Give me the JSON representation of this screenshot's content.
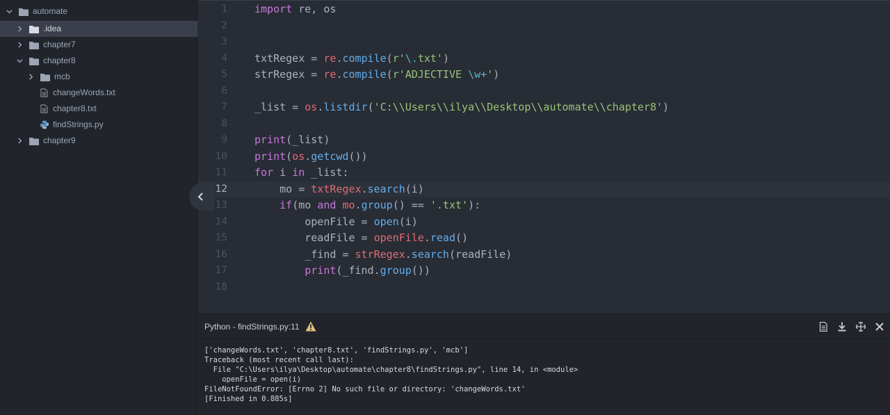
{
  "tree": {
    "root": "automate",
    "items": [
      {
        "label": ".idea",
        "kind": "folder",
        "state": "collapsed",
        "depth": 1,
        "selected": true
      },
      {
        "label": "chapter7",
        "kind": "folder",
        "state": "collapsed",
        "depth": 1,
        "selected": false
      },
      {
        "label": "chapter8",
        "kind": "folder",
        "state": "expanded",
        "depth": 1,
        "selected": false
      },
      {
        "label": "mcb",
        "kind": "folder",
        "state": "collapsed",
        "depth": 2,
        "selected": false
      },
      {
        "label": "changeWords.txt",
        "kind": "file-text",
        "depth": 2,
        "selected": false
      },
      {
        "label": "chapter8.txt",
        "kind": "file-text",
        "depth": 2,
        "selected": false
      },
      {
        "label": "findStrings.py",
        "kind": "file-python",
        "depth": 2,
        "selected": false
      },
      {
        "label": "chapter9",
        "kind": "folder",
        "state": "collapsed",
        "depth": 1,
        "selected": false
      }
    ]
  },
  "editor": {
    "cursor_line": 12,
    "lines": [
      {
        "no": "1",
        "tokens": [
          {
            "t": "import",
            "c": "kw"
          },
          {
            "t": " re, os",
            "c": "pl"
          }
        ]
      },
      {
        "no": "2",
        "tokens": []
      },
      {
        "no": "3",
        "tokens": []
      },
      {
        "no": "4",
        "tokens": [
          {
            "t": "txtRegex = ",
            "c": "pl"
          },
          {
            "t": "re",
            "c": "var"
          },
          {
            "t": ".",
            "c": "pl"
          },
          {
            "t": "compile",
            "c": "fn"
          },
          {
            "t": "(",
            "c": "pl"
          },
          {
            "t": "r'",
            "c": "str"
          },
          {
            "t": "\\.",
            "c": "esc"
          },
          {
            "t": "txt'",
            "c": "str"
          },
          {
            "t": ")",
            "c": "pl"
          }
        ]
      },
      {
        "no": "5",
        "tokens": [
          {
            "t": "strRegex = ",
            "c": "pl"
          },
          {
            "t": "re",
            "c": "var"
          },
          {
            "t": ".",
            "c": "pl"
          },
          {
            "t": "compile",
            "c": "fn"
          },
          {
            "t": "(",
            "c": "pl"
          },
          {
            "t": "r'ADJECTIVE ",
            "c": "str"
          },
          {
            "t": "\\w+",
            "c": "esc"
          },
          {
            "t": "'",
            "c": "str"
          },
          {
            "t": ")",
            "c": "pl"
          }
        ]
      },
      {
        "no": "6",
        "tokens": []
      },
      {
        "no": "7",
        "tokens": [
          {
            "t": "_list = ",
            "c": "pl"
          },
          {
            "t": "os",
            "c": "var"
          },
          {
            "t": ".",
            "c": "pl"
          },
          {
            "t": "listdir",
            "c": "fn"
          },
          {
            "t": "(",
            "c": "pl"
          },
          {
            "t": "'C:\\\\Users\\\\ilya\\\\Desktop\\\\automate\\\\chapter8'",
            "c": "str"
          },
          {
            "t": ")",
            "c": "pl"
          }
        ]
      },
      {
        "no": "8",
        "tokens": []
      },
      {
        "no": "9",
        "tokens": [
          {
            "t": "print",
            "c": "kw"
          },
          {
            "t": "(_list)",
            "c": "pl"
          }
        ]
      },
      {
        "no": "10",
        "tokens": [
          {
            "t": "print",
            "c": "kw"
          },
          {
            "t": "(",
            "c": "pl"
          },
          {
            "t": "os",
            "c": "var"
          },
          {
            "t": ".",
            "c": "pl"
          },
          {
            "t": "getcwd",
            "c": "fn"
          },
          {
            "t": "())",
            "c": "pl"
          }
        ]
      },
      {
        "no": "11",
        "tokens": [
          {
            "t": "for",
            "c": "kw"
          },
          {
            "t": " i ",
            "c": "pl"
          },
          {
            "t": "in",
            "c": "kw"
          },
          {
            "t": " _list:",
            "c": "pl"
          }
        ]
      },
      {
        "no": "12",
        "tokens": [
          {
            "t": "    mo = ",
            "c": "pl"
          },
          {
            "t": "txtRegex",
            "c": "var"
          },
          {
            "t": ".",
            "c": "pl"
          },
          {
            "t": "search",
            "c": "fn"
          },
          {
            "t": "(i)",
            "c": "pl"
          }
        ]
      },
      {
        "no": "13",
        "tokens": [
          {
            "t": "    ",
            "c": "pl"
          },
          {
            "t": "if",
            "c": "kw"
          },
          {
            "t": "(mo ",
            "c": "pl"
          },
          {
            "t": "and",
            "c": "kw"
          },
          {
            "t": " ",
            "c": "pl"
          },
          {
            "t": "mo",
            "c": "var"
          },
          {
            "t": ".",
            "c": "pl"
          },
          {
            "t": "group",
            "c": "fn"
          },
          {
            "t": "() == ",
            "c": "pl"
          },
          {
            "t": "'.txt'",
            "c": "str"
          },
          {
            "t": "):",
            "c": "pl"
          }
        ]
      },
      {
        "no": "14",
        "tokens": [
          {
            "t": "        openFile = ",
            "c": "pl"
          },
          {
            "t": "open",
            "c": "fn"
          },
          {
            "t": "(i)",
            "c": "pl"
          }
        ]
      },
      {
        "no": "15",
        "tokens": [
          {
            "t": "        readFile = ",
            "c": "pl"
          },
          {
            "t": "openFile",
            "c": "var"
          },
          {
            "t": ".",
            "c": "pl"
          },
          {
            "t": "read",
            "c": "fn"
          },
          {
            "t": "()",
            "c": "pl"
          }
        ]
      },
      {
        "no": "16",
        "tokens": [
          {
            "t": "        _find = ",
            "c": "pl"
          },
          {
            "t": "strRegex",
            "c": "var"
          },
          {
            "t": ".",
            "c": "pl"
          },
          {
            "t": "search",
            "c": "fn"
          },
          {
            "t": "(readFile)",
            "c": "pl"
          }
        ]
      },
      {
        "no": "17",
        "tokens": [
          {
            "t": "        ",
            "c": "pl"
          },
          {
            "t": "print",
            "c": "kw"
          },
          {
            "t": "(_find.",
            "c": "pl"
          },
          {
            "t": "group",
            "c": "fn"
          },
          {
            "t": "())",
            "c": "pl"
          }
        ]
      },
      {
        "no": "18",
        "tokens": []
      }
    ]
  },
  "panel": {
    "title": "Python - findStrings.py:11",
    "output": [
      "['changeWords.txt', 'chapter8.txt', 'findStrings.py', 'mcb']",
      "Traceback (most recent call last):",
      "  File \"C:\\Users\\ilya\\Desktop\\automate\\chapter8\\findStrings.py\", line 14, in <module>",
      "    openFile = open(i)",
      "FileNotFoundError: [Errno 2] No such file or directory: 'changeWords.txt'",
      "[Finished in 0.885s]"
    ],
    "actions": [
      "document-icon",
      "download-icon",
      "pin-icon",
      "close-icon"
    ]
  },
  "colors": {
    "keyword": "#c678dd",
    "function": "#61afef",
    "variable": "#e06c75",
    "string": "#98c379",
    "escape": "#56b6c2",
    "plain": "#abb2bf",
    "warning": "#e5c07b"
  }
}
